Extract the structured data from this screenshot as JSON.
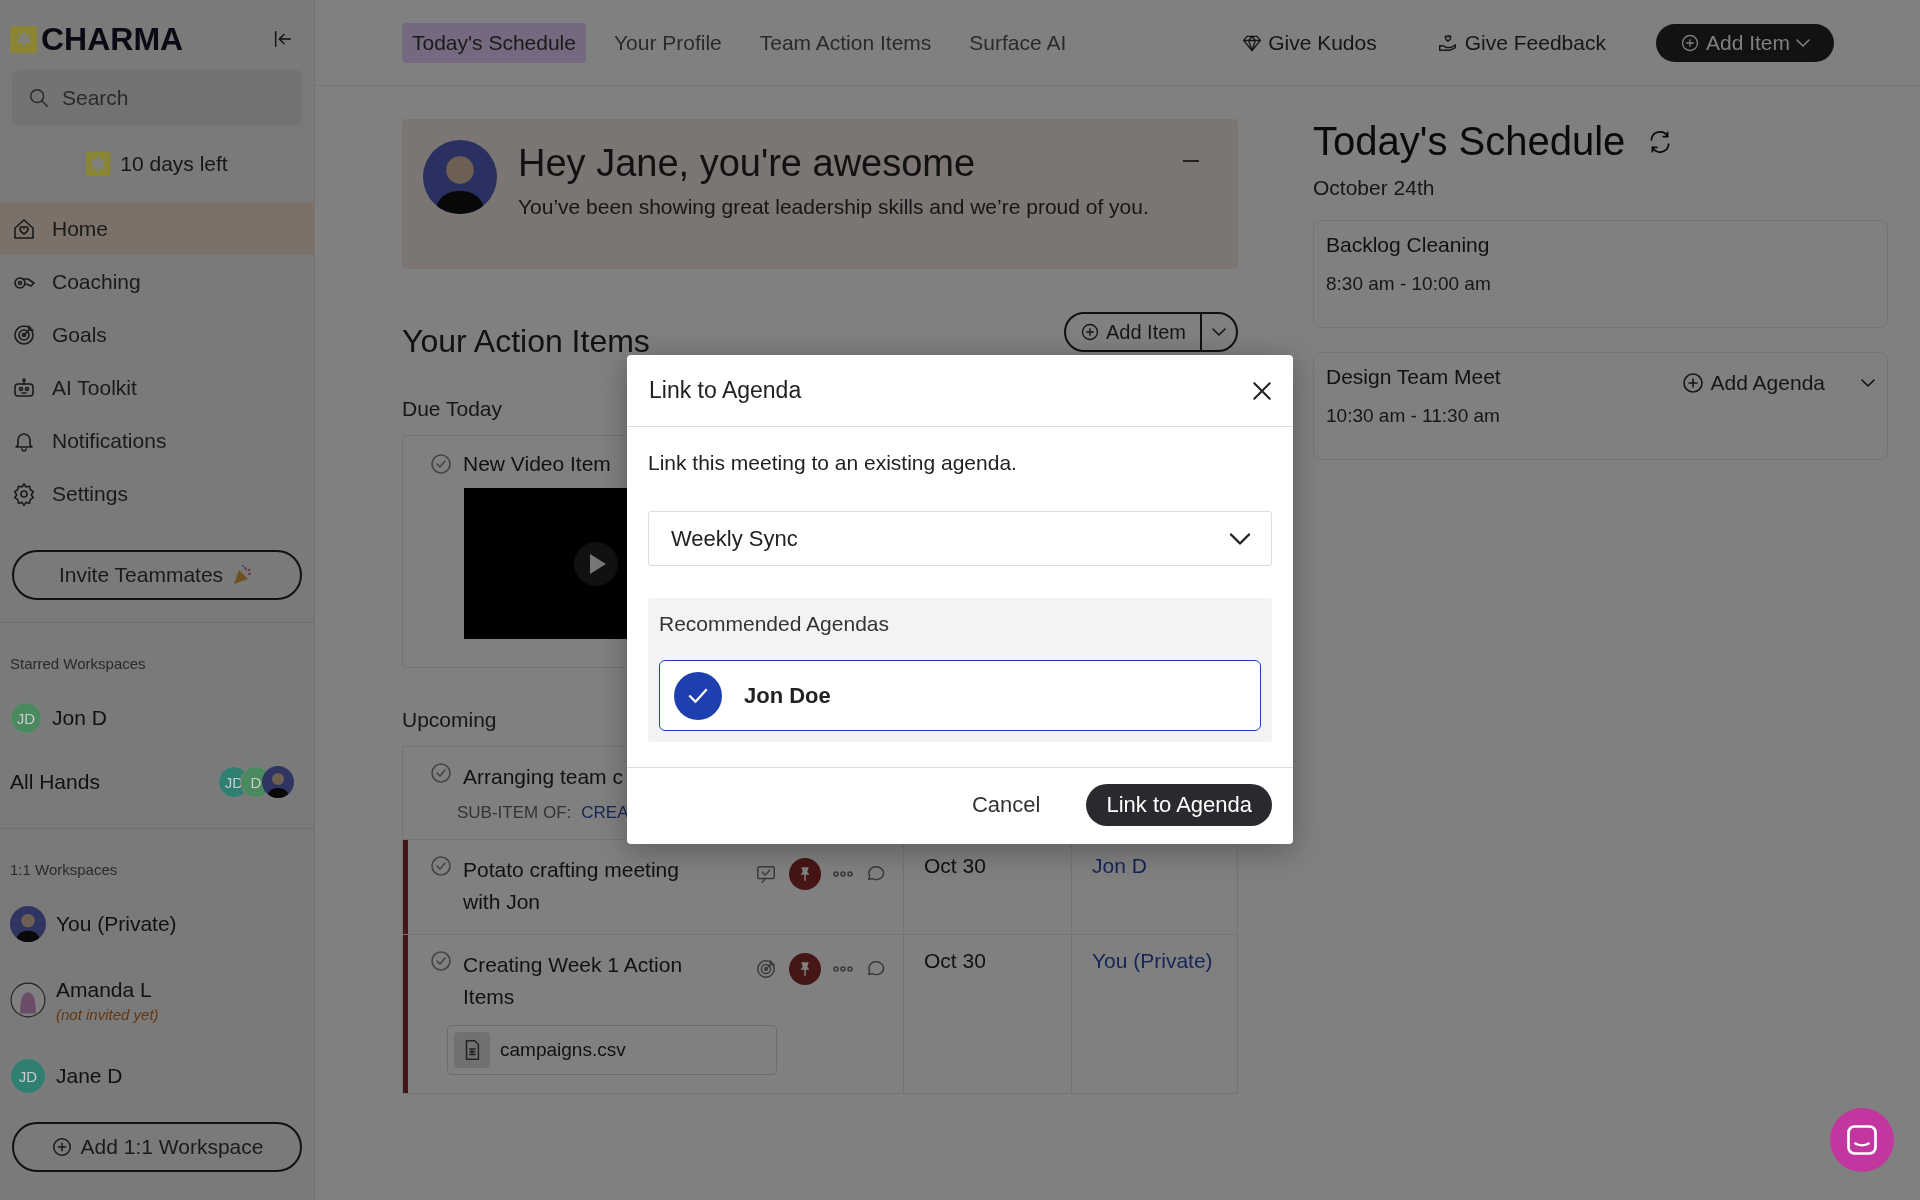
{
  "sidebar": {
    "logo": "CHARMA",
    "search": {
      "placeholder": "Search"
    },
    "trial": "10 days left",
    "nav": [
      {
        "label": "Home",
        "kind": "home",
        "selected": true
      },
      {
        "label": "Coaching",
        "kind": "coaching",
        "selected": false
      },
      {
        "label": "Goals",
        "kind": "goals",
        "selected": false
      },
      {
        "label": "AI Toolkit",
        "kind": "ai",
        "selected": false
      },
      {
        "label": "Notifications",
        "kind": "notifications",
        "selected": false
      },
      {
        "label": "Settings",
        "kind": "settings",
        "selected": false
      }
    ],
    "invite_button": "Invite Teammates",
    "starred": {
      "heading": "Starred Workspaces",
      "items": [
        {
          "name": "Jon D",
          "kind": "person",
          "avatars": [
            {
              "kind": "initials",
              "initials": "JD",
              "color": "#4a8a5e"
            }
          ]
        },
        {
          "name": "All Hands",
          "kind": "group",
          "avatars": [
            {
              "kind": "initials",
              "initials": "JD",
              "color": "#2f7f73"
            },
            {
              "kind": "initials",
              "initials": "D",
              "color": "#4a8a5e"
            },
            {
              "kind": "photo"
            }
          ]
        }
      ]
    },
    "one_on_one": {
      "heading": "1:1 Workspaces",
      "items": [
        {
          "name": "You (Private)",
          "avatar": {
            "kind": "photo"
          }
        },
        {
          "name": "Amanda L",
          "note": "(not invited yet)",
          "avatar": {
            "kind": "blob"
          }
        },
        {
          "name": "Jane D",
          "avatar": {
            "kind": "initials",
            "initials": "JD",
            "color": "#2f7f73"
          }
        }
      ]
    },
    "add_workspace_button": "Add 1:1 Workspace"
  },
  "top_bar": {
    "tabs": [
      {
        "label": "Today's Schedule",
        "selected": true
      },
      {
        "label": "Your Profile",
        "selected": false
      },
      {
        "label": "Team Action Items",
        "selected": false
      },
      {
        "label": "Surface AI",
        "selected": false
      }
    ],
    "actions": [
      {
        "label": "Give Kudos",
        "kind": "kudos"
      },
      {
        "label": "Give Feedback",
        "kind": "feedback"
      },
      {
        "label": "Add Item",
        "kind": "primary"
      }
    ]
  },
  "banner": {
    "title": "Hey Jane, you're awesome",
    "message": "You’ve been showing great leadership skills and we’re proud of you."
  },
  "action_items": {
    "heading": "Your Action Items",
    "add_button": "Add Item",
    "due_today": {
      "label": "Due Today",
      "items": [
        {
          "title": "New Video Item",
          "attachment": {
            "kind": "video"
          }
        }
      ]
    },
    "upcoming": {
      "label": "Upcoming",
      "items": [
        {
          "kind": "sub_item",
          "title": "Arranging team c",
          "sub_item_label": "SUB-ITEM OF:",
          "sub_item_link": "CREA",
          "highlighted": false
        },
        {
          "kind": "task",
          "title": "Potato crafting meeting with Jon",
          "tag": {
            "kind": "note"
          },
          "due": "Oct 30",
          "workspace": "Jon D",
          "highlighted": true
        },
        {
          "kind": "task",
          "title": "Creating Week 1 Action Items",
          "tag": {
            "kind": "goal"
          },
          "due": "Oct 30",
          "workspace": "You (Private)",
          "highlighted": true,
          "attachment": {
            "kind": "file",
            "name": "campaigns.csv"
          }
        }
      ]
    }
  },
  "schedule": {
    "title": "Today's Schedule",
    "date": "October 24th",
    "events": [
      {
        "title": "Backlog Cleaning",
        "time": "8:30 am - 10:00 am"
      },
      {
        "title": "Design Team Meet",
        "time": "10:30 am - 11:30 am",
        "add_agenda": "Add Agenda"
      }
    ]
  },
  "modal": {
    "title": "Link to Agenda",
    "description": "Link this meeting to an existing agenda.",
    "select": {
      "value": "Weekly Sync"
    },
    "recommended": {
      "heading": "Recommended Agendas",
      "options": [
        {
          "label": "Jon Doe",
          "selected": true
        }
      ]
    },
    "buttons": [
      {
        "label": "Cancel",
        "kind": "secondary"
      },
      {
        "label": "Link to Agenda",
        "kind": "primary"
      }
    ]
  }
}
